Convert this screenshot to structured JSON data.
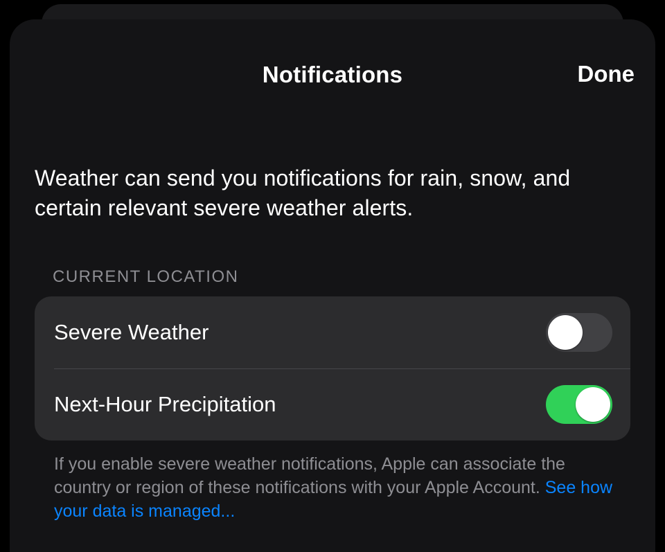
{
  "nav": {
    "title": "Notifications",
    "done": "Done"
  },
  "intro": "Weather can send you notifications for rain, snow, and certain relevant severe weather alerts.",
  "section": {
    "header": "CURRENT LOCATION",
    "rows": [
      {
        "label": "Severe Weather",
        "on": false
      },
      {
        "label": "Next-Hour Precipitation",
        "on": true
      }
    ],
    "footer_text": "If you enable severe weather notifications, Apple can associate the country or region of these notifications with your Apple Account. ",
    "footer_link": "See how your data is managed..."
  },
  "colors": {
    "accent_green": "#30d158",
    "link_blue": "#0a84ff"
  }
}
